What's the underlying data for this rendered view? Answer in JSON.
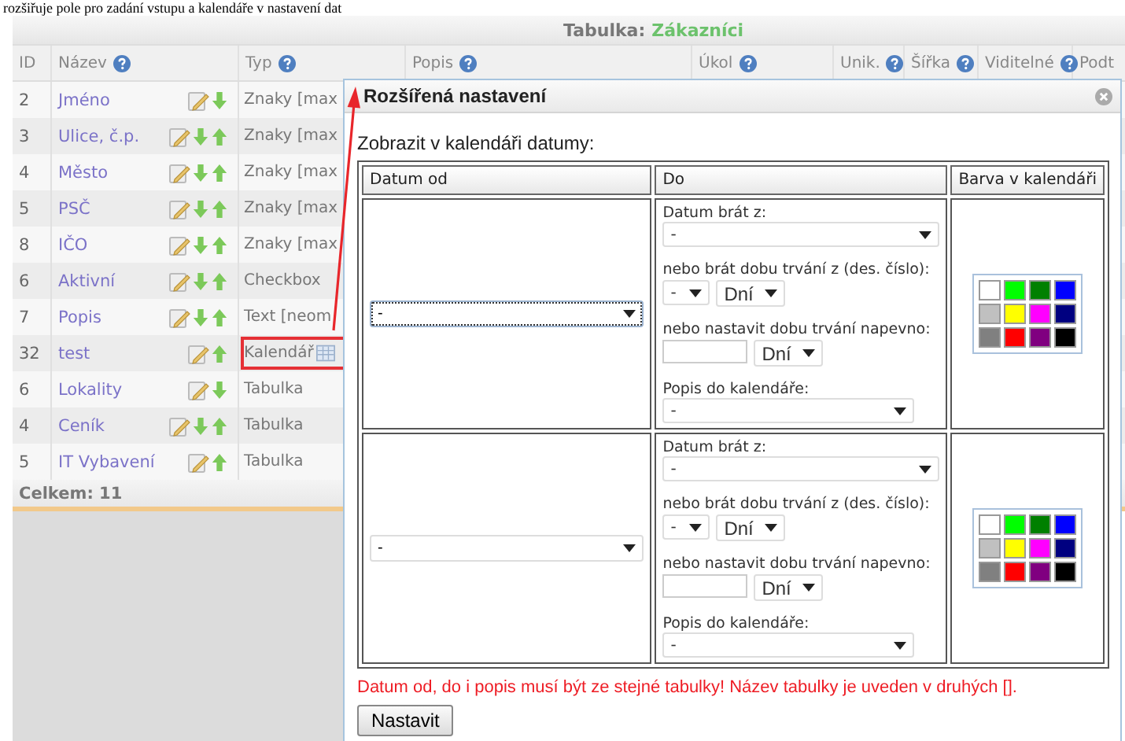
{
  "heading": "rozšiřuje pole pro zadání vstupu a kalendáře v nastavení dat",
  "table": {
    "title_label": "Tabulka:",
    "title_value": "Zákazníci",
    "columns": [
      {
        "label": "ID",
        "help": false
      },
      {
        "label": "Název",
        "help": true
      },
      {
        "label": "Typ",
        "help": true
      },
      {
        "label": "Popis",
        "help": true
      },
      {
        "label": "Úkol",
        "help": true
      },
      {
        "label": "Unik.",
        "help": true
      },
      {
        "label": "Šířka",
        "help": true
      },
      {
        "label": "Viditelné",
        "help": true
      },
      {
        "label": "Podt",
        "help": false
      }
    ],
    "rows": [
      {
        "id": "2",
        "name": "Jméno",
        "type": "Znaky [max",
        "down": true,
        "up": false,
        "kind": "plain",
        "highlighted": false
      },
      {
        "id": "3",
        "name": "Ulice, č.p.",
        "type": "Znaky [max",
        "down": true,
        "up": true,
        "kind": "plain",
        "highlighted": false
      },
      {
        "id": "4",
        "name": "Město",
        "type": "Znaky [max",
        "down": true,
        "up": true,
        "kind": "plain",
        "highlighted": false
      },
      {
        "id": "5",
        "name": "PSČ",
        "type": "Znaky [max",
        "down": true,
        "up": true,
        "kind": "plain",
        "highlighted": false
      },
      {
        "id": "8",
        "name": "IČO",
        "type": "Znaky [max",
        "down": true,
        "up": true,
        "kind": "plain",
        "highlighted": false
      },
      {
        "id": "6",
        "name": "Aktivní",
        "type": "Checkbox",
        "down": true,
        "up": true,
        "kind": "plain",
        "highlighted": false
      },
      {
        "id": "7",
        "name": "Popis",
        "type": "Text [neom",
        "down": true,
        "up": true,
        "kind": "plain",
        "highlighted": false
      },
      {
        "id": "32",
        "name": "test",
        "type": "Kalendář",
        "down": false,
        "up": true,
        "kind": "calendar",
        "highlighted": true
      },
      {
        "id": "6",
        "name": "Lokality",
        "type": "Tabulka",
        "down": true,
        "up": false,
        "kind": "plain",
        "highlighted": false
      },
      {
        "id": "4",
        "name": "Ceník",
        "type": "Tabulka",
        "down": true,
        "up": true,
        "kind": "plain",
        "highlighted": false
      },
      {
        "id": "5",
        "name": "IT Vybavení",
        "type": "Tabulka",
        "down": false,
        "up": true,
        "kind": "plain",
        "highlighted": false
      }
    ],
    "footer": "Celkem: 11"
  },
  "dialog": {
    "title": "Rozšířená nastavení",
    "intro": "Zobrazit v kalendáři datumy:",
    "columns": [
      "Datum od",
      "Do",
      "Barva v kalendáři"
    ],
    "rows": [
      {
        "from_value": "-",
        "focused": true,
        "date_label": "Datum brát z:",
        "date_value": "-",
        "duration_label": "nebo brát dobu trvání z (des. číslo):",
        "duration_value": "-",
        "duration_unit": "Dní",
        "fixed_label": "nebo nastavit dobu trvání napevno:",
        "fixed_unit": "Dní",
        "desc_label": "Popis do kalendáře:",
        "desc_value": "-",
        "colors": [
          {
            "color": "#ffffff"
          },
          {
            "color": "#00ff00"
          },
          {
            "color": "#008000"
          },
          {
            "color": "#0000ff"
          },
          {
            "color": "#c0c0c0"
          },
          {
            "color": "#ffff00"
          },
          {
            "color": "#ff00ff"
          },
          {
            "color": "#000080"
          },
          {
            "color": "#808080"
          },
          {
            "color": "#ff0000"
          },
          {
            "color": "#800080"
          },
          {
            "color": "#000000"
          }
        ]
      },
      {
        "from_value": "-",
        "focused": false,
        "date_label": "Datum brát z:",
        "date_value": "-",
        "duration_label": "nebo brát dobu trvání z (des. číslo):",
        "duration_value": "-",
        "duration_unit": "Dní",
        "fixed_label": "nebo nastavit dobu trvání napevno:",
        "fixed_unit": "Dní",
        "desc_label": "Popis do kalendáře:",
        "desc_value": "-",
        "colors": [
          {
            "color": "#ffffff"
          },
          {
            "color": "#00ff00"
          },
          {
            "color": "#008000"
          },
          {
            "color": "#0000ff"
          },
          {
            "color": "#c0c0c0"
          },
          {
            "color": "#ffff00"
          },
          {
            "color": "#ff00ff"
          },
          {
            "color": "#000080"
          },
          {
            "color": "#808080"
          },
          {
            "color": "#ff0000"
          },
          {
            "color": "#800080"
          },
          {
            "color": "#000000"
          }
        ]
      }
    ],
    "note": "Datum od, do i popis musí být ze stejné tabulky! Název tabulky je uveden v druhých [].",
    "button": "Nastavit"
  }
}
